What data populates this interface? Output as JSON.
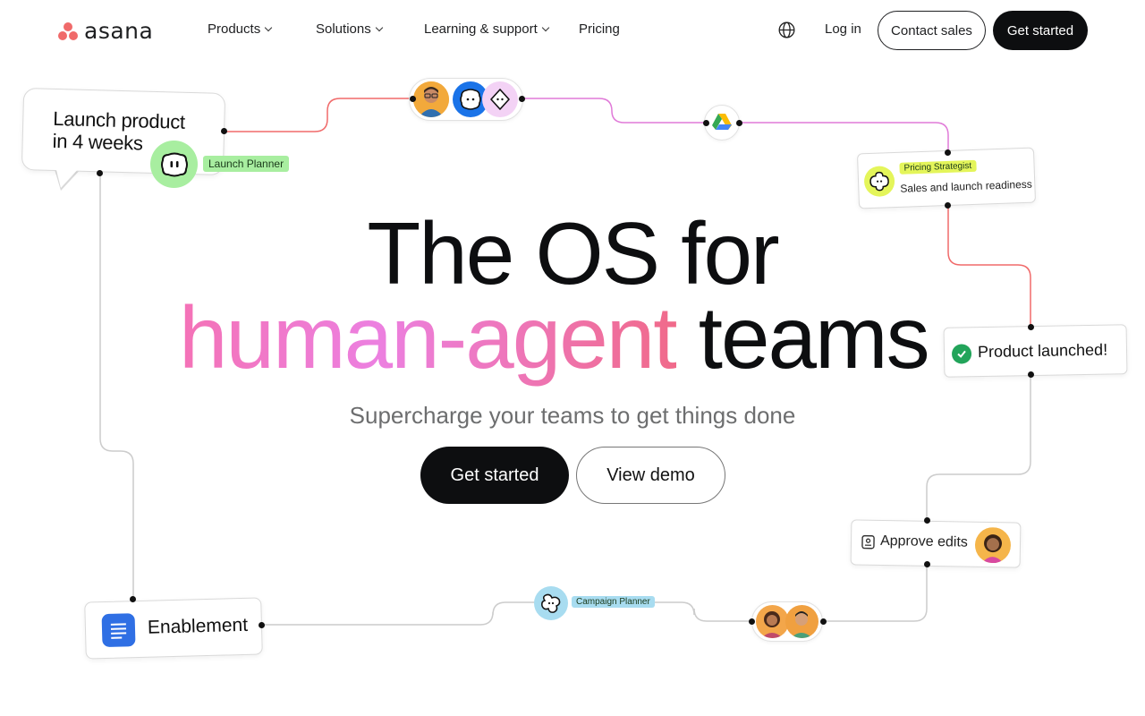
{
  "brand": {
    "name": "asana",
    "accent": "#f06a6a"
  },
  "nav": {
    "items": [
      {
        "label": "Products",
        "has_dropdown": true
      },
      {
        "label": "Solutions",
        "has_dropdown": true
      },
      {
        "label": "Learning & support",
        "has_dropdown": true
      },
      {
        "label": "Pricing",
        "has_dropdown": false
      }
    ],
    "language_icon": "globe-icon",
    "login": "Log in",
    "contact_sales": "Contact sales",
    "get_started": "Get started"
  },
  "hero": {
    "line1": "The OS for",
    "line2_gradient": "human-agent",
    "line2_dark": "teams",
    "subtitle": "Supercharge your teams to get things done",
    "primary_cta": "Get started",
    "secondary_cta": "View demo",
    "gradient_colors": [
      "#f472b6",
      "#ec80e0",
      "#f06a8a"
    ]
  },
  "workflow": {
    "launch_card": {
      "line1": "Launch product",
      "line2": "in 4 weeks"
    },
    "launch_planner_tag": "Launch Planner",
    "pricing_card": {
      "tag": "Pricing Strategist",
      "text": "Sales and launch readiness"
    },
    "product_card": {
      "text": "Product launched!"
    },
    "approve_card": {
      "text": "Approve edits"
    },
    "enablement_card": {
      "text": "Enablement"
    },
    "campaign_tag": "Campaign Planner",
    "colors": {
      "line_red": "#f06a6a",
      "line_pink": "#e07ad8",
      "line_gray": "#c8c8c8",
      "launch_tag_bg": "#a8eea0",
      "pricing_tag_bg": "#e4f55a",
      "campaign_tag_bg": "#a8dcf0"
    }
  }
}
